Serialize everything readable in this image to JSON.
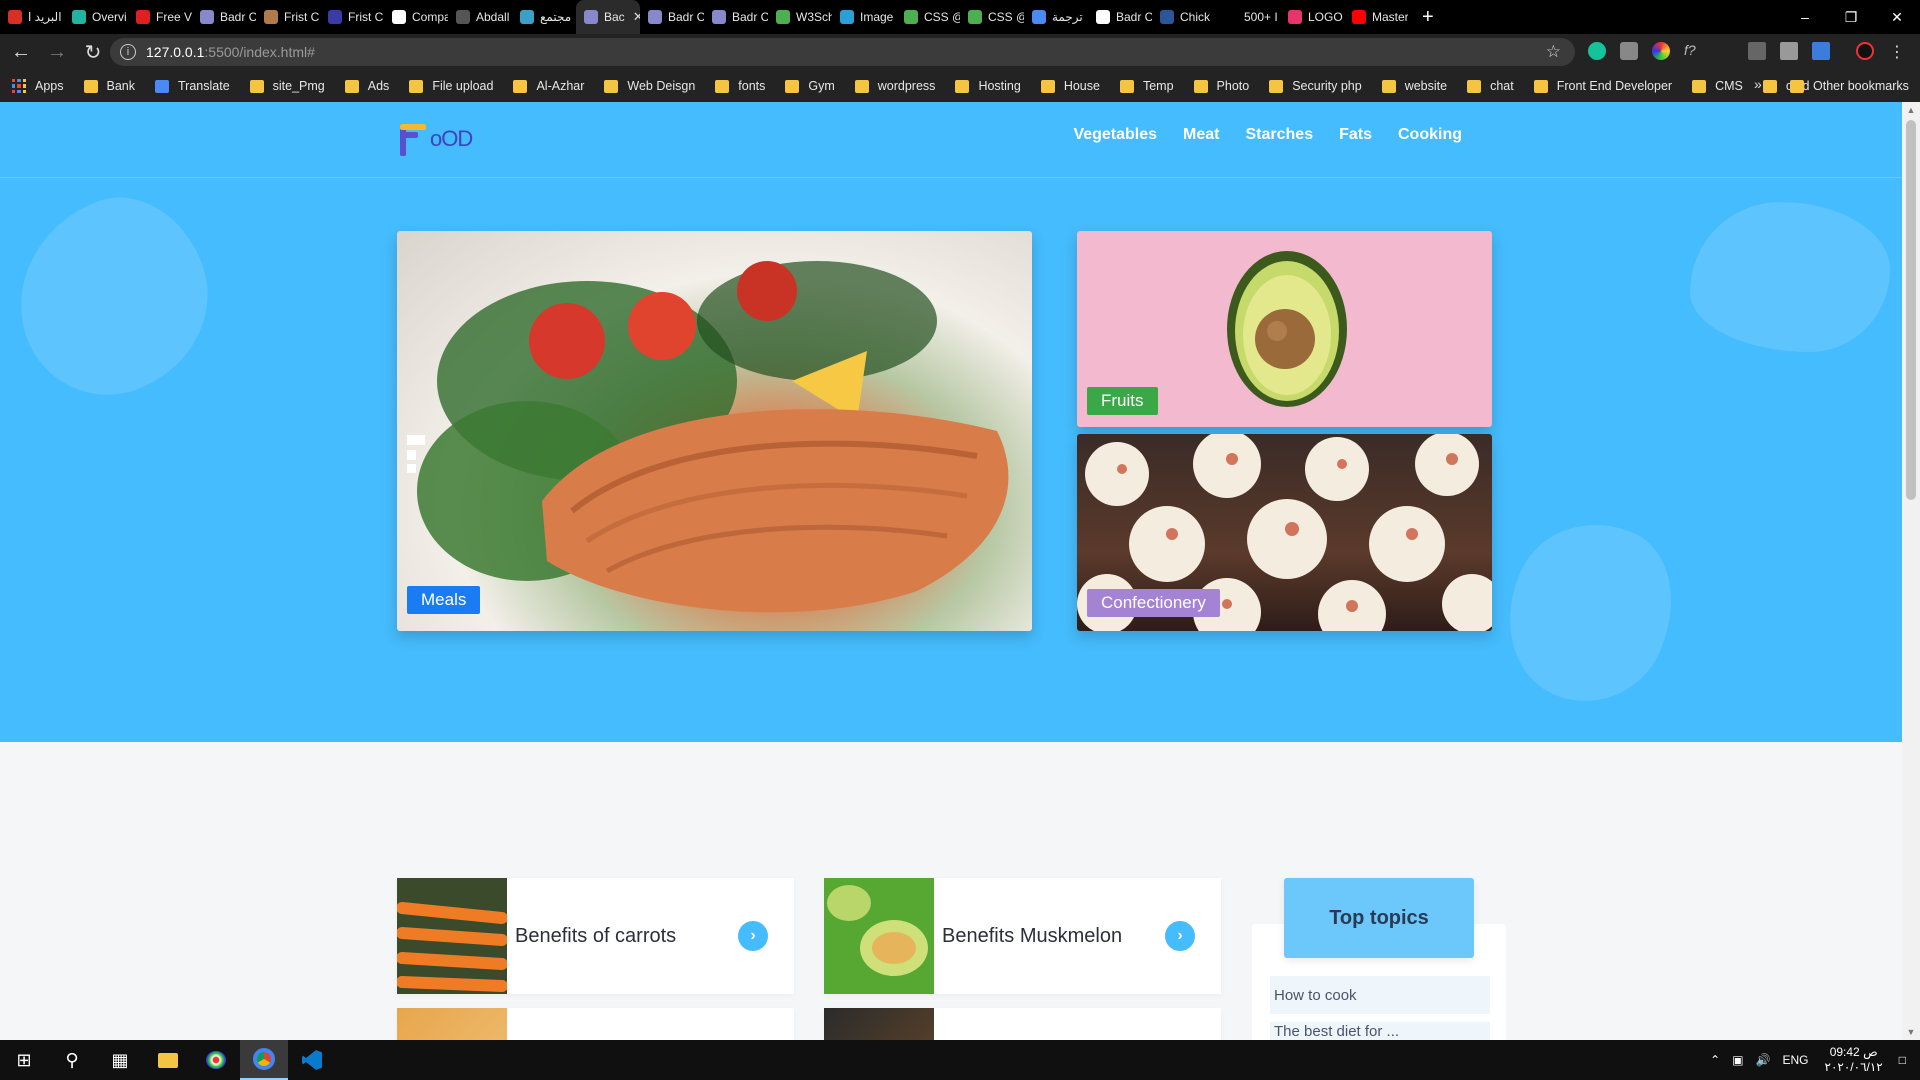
{
  "browser": {
    "tabs": [
      {
        "title": "البريد ا",
        "color": "#d93025"
      },
      {
        "title": "Overvi",
        "color": "#1fb5a0"
      },
      {
        "title": "Free Vi",
        "color": "#e02020"
      },
      {
        "title": "Badr C",
        "color": "#8888cc"
      },
      {
        "title": "Frist C",
        "color": "#b07a4a"
      },
      {
        "title": "Frist C",
        "color": "#3a3aa8"
      },
      {
        "title": "Compa",
        "color": "#ffffff"
      },
      {
        "title": "Abdall",
        "color": "#555555"
      },
      {
        "title": "مجتمع",
        "color": "#3aa0c8"
      },
      {
        "title": "Bac",
        "color": "#8888cc",
        "active": true
      },
      {
        "title": "Badr C",
        "color": "#8888cc"
      },
      {
        "title": "Badr C",
        "color": "#8888cc"
      },
      {
        "title": "W3Sch",
        "color": "#4caf50"
      },
      {
        "title": "Image",
        "color": "#2aa0d8"
      },
      {
        "title": "CSS @",
        "color": "#4caf50"
      },
      {
        "title": "CSS @",
        "color": "#4caf50"
      },
      {
        "title": "ترجمة",
        "color": "#4a8af4"
      },
      {
        "title": "Badr C",
        "color": "#ffffff"
      },
      {
        "title": "Chick",
        "color": "#2b579a"
      },
      {
        "title": "500+ I",
        "color": "#000000"
      },
      {
        "title": "LOGO",
        "color": "#e8336d"
      },
      {
        "title": "Master",
        "color": "#ff0000"
      }
    ],
    "tab_close_label": "✕",
    "new_tab_label": "+",
    "window_controls": {
      "minimize": "–",
      "restore": "❐",
      "close": "✕"
    },
    "url_host": "127.0.0.1",
    "url_path": ":5500/index.html#",
    "bookmarks": [
      "Apps",
      "Bank",
      "Translate",
      "site_Pmg",
      "Ads",
      "File upload",
      "Al-Azhar",
      "Web Deisgn",
      "fonts",
      "Gym",
      "wordpress",
      "Hosting",
      "House",
      "Temp",
      "Photo",
      "Security php",
      "website",
      "chat",
      "Front End Developer",
      "CMS",
      "cmd"
    ],
    "bookmarks_more": "»",
    "other_bookmarks": "Other bookmarks"
  },
  "site": {
    "logo_text": "oOD",
    "nav": [
      "Vegetables",
      "Meat",
      "Starches",
      "Fats",
      "Cooking"
    ],
    "hero_cards": {
      "meals": {
        "label": "Meals",
        "tag_color": "#1a7cf2"
      },
      "fruits": {
        "label": "Fruits",
        "tag_color": "#3aa847"
      },
      "confectionery": {
        "label": "Confectionery",
        "tag_color": "#a583d4"
      }
    },
    "posts": [
      {
        "title": "Benefits of carrots",
        "arrow": "›"
      },
      {
        "title": "Benefits Muskmelon",
        "arrow": "›"
      }
    ],
    "top_topics": {
      "heading": "Top topics",
      "items": [
        "How to cook",
        "The best diet for ..."
      ]
    }
  },
  "taskbar": {
    "language": "ENG",
    "time": "09:42 ص",
    "date": "٢٠٢٠/٠٦/١٢"
  },
  "colors": {
    "hero_bg": "#45bcfd",
    "page_bg": "#f5f6f8",
    "accent_blue": "#45bcfd",
    "logo_text": "#3d43c2"
  }
}
